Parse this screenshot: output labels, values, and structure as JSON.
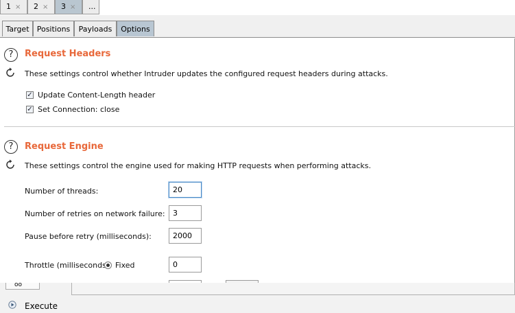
{
  "top_tabs": [
    {
      "label": "1",
      "close": "×"
    },
    {
      "label": "2",
      "close": "×"
    },
    {
      "label": "3",
      "close": "×"
    },
    {
      "label": "..."
    }
  ],
  "sub_tabs": [
    "Target",
    "Positions",
    "Payloads",
    "Options"
  ],
  "request_headers": {
    "title": "Request Headers",
    "description": "These settings control whether Intruder updates the configured request headers during attacks.",
    "checkboxes": [
      {
        "label": "Update Content-Length header",
        "checked": true
      },
      {
        "label": "Set Connection: close",
        "checked": true
      }
    ]
  },
  "request_engine": {
    "title": "Request Engine",
    "description": "These settings control the engine used for making HTTP requests when performing attacks.",
    "threads_label": "Number of threads:",
    "threads_value": "20",
    "retries_label": "Number of retries on network failure:",
    "retries_value": "3",
    "pause_label": "Pause before retry (milliseconds):",
    "pause_value": "2000",
    "throttle_label": "Throttle (milliseconds):",
    "throttle_option": "Fixed",
    "throttle_value": "0"
  },
  "bottom": {
    "execute_label": "Execute",
    "dropdown_label": "oo"
  },
  "colors": {
    "accent_title": "#e8683a",
    "active_tab": "#b8c6d2"
  }
}
